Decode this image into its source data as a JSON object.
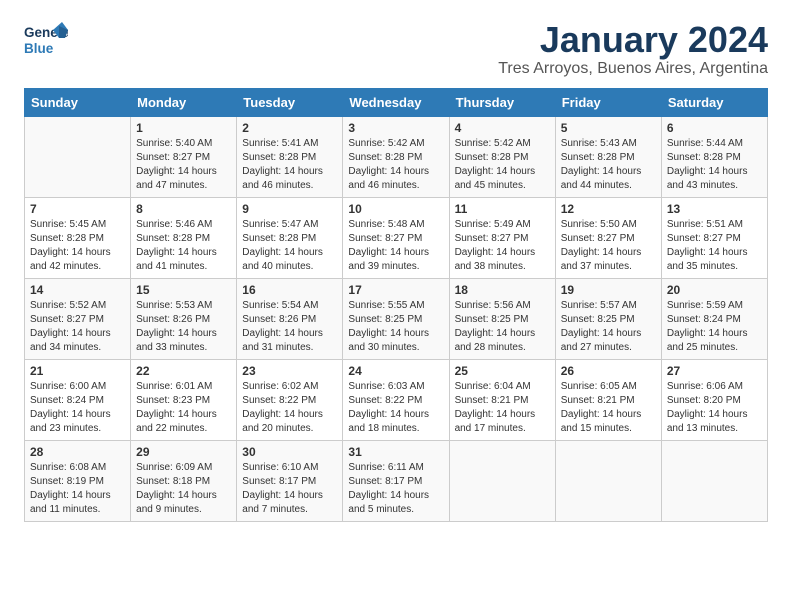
{
  "logo": {
    "line1": "General",
    "line2": "Blue"
  },
  "title": "January 2024",
  "subtitle": "Tres Arroyos, Buenos Aires, Argentina",
  "days_of_week": [
    "Sunday",
    "Monday",
    "Tuesday",
    "Wednesday",
    "Thursday",
    "Friday",
    "Saturday"
  ],
  "weeks": [
    [
      {
        "day": "",
        "content": ""
      },
      {
        "day": "1",
        "content": "Sunrise: 5:40 AM\nSunset: 8:27 PM\nDaylight: 14 hours\nand 47 minutes."
      },
      {
        "day": "2",
        "content": "Sunrise: 5:41 AM\nSunset: 8:28 PM\nDaylight: 14 hours\nand 46 minutes."
      },
      {
        "day": "3",
        "content": "Sunrise: 5:42 AM\nSunset: 8:28 PM\nDaylight: 14 hours\nand 46 minutes."
      },
      {
        "day": "4",
        "content": "Sunrise: 5:42 AM\nSunset: 8:28 PM\nDaylight: 14 hours\nand 45 minutes."
      },
      {
        "day": "5",
        "content": "Sunrise: 5:43 AM\nSunset: 8:28 PM\nDaylight: 14 hours\nand 44 minutes."
      },
      {
        "day": "6",
        "content": "Sunrise: 5:44 AM\nSunset: 8:28 PM\nDaylight: 14 hours\nand 43 minutes."
      }
    ],
    [
      {
        "day": "7",
        "content": "Sunrise: 5:45 AM\nSunset: 8:28 PM\nDaylight: 14 hours\nand 42 minutes."
      },
      {
        "day": "8",
        "content": "Sunrise: 5:46 AM\nSunset: 8:28 PM\nDaylight: 14 hours\nand 41 minutes."
      },
      {
        "day": "9",
        "content": "Sunrise: 5:47 AM\nSunset: 8:28 PM\nDaylight: 14 hours\nand 40 minutes."
      },
      {
        "day": "10",
        "content": "Sunrise: 5:48 AM\nSunset: 8:27 PM\nDaylight: 14 hours\nand 39 minutes."
      },
      {
        "day": "11",
        "content": "Sunrise: 5:49 AM\nSunset: 8:27 PM\nDaylight: 14 hours\nand 38 minutes."
      },
      {
        "day": "12",
        "content": "Sunrise: 5:50 AM\nSunset: 8:27 PM\nDaylight: 14 hours\nand 37 minutes."
      },
      {
        "day": "13",
        "content": "Sunrise: 5:51 AM\nSunset: 8:27 PM\nDaylight: 14 hours\nand 35 minutes."
      }
    ],
    [
      {
        "day": "14",
        "content": "Sunrise: 5:52 AM\nSunset: 8:27 PM\nDaylight: 14 hours\nand 34 minutes."
      },
      {
        "day": "15",
        "content": "Sunrise: 5:53 AM\nSunset: 8:26 PM\nDaylight: 14 hours\nand 33 minutes."
      },
      {
        "day": "16",
        "content": "Sunrise: 5:54 AM\nSunset: 8:26 PM\nDaylight: 14 hours\nand 31 minutes."
      },
      {
        "day": "17",
        "content": "Sunrise: 5:55 AM\nSunset: 8:25 PM\nDaylight: 14 hours\nand 30 minutes."
      },
      {
        "day": "18",
        "content": "Sunrise: 5:56 AM\nSunset: 8:25 PM\nDaylight: 14 hours\nand 28 minutes."
      },
      {
        "day": "19",
        "content": "Sunrise: 5:57 AM\nSunset: 8:25 PM\nDaylight: 14 hours\nand 27 minutes."
      },
      {
        "day": "20",
        "content": "Sunrise: 5:59 AM\nSunset: 8:24 PM\nDaylight: 14 hours\nand 25 minutes."
      }
    ],
    [
      {
        "day": "21",
        "content": "Sunrise: 6:00 AM\nSunset: 8:24 PM\nDaylight: 14 hours\nand 23 minutes."
      },
      {
        "day": "22",
        "content": "Sunrise: 6:01 AM\nSunset: 8:23 PM\nDaylight: 14 hours\nand 22 minutes."
      },
      {
        "day": "23",
        "content": "Sunrise: 6:02 AM\nSunset: 8:22 PM\nDaylight: 14 hours\nand 20 minutes."
      },
      {
        "day": "24",
        "content": "Sunrise: 6:03 AM\nSunset: 8:22 PM\nDaylight: 14 hours\nand 18 minutes."
      },
      {
        "day": "25",
        "content": "Sunrise: 6:04 AM\nSunset: 8:21 PM\nDaylight: 14 hours\nand 17 minutes."
      },
      {
        "day": "26",
        "content": "Sunrise: 6:05 AM\nSunset: 8:21 PM\nDaylight: 14 hours\nand 15 minutes."
      },
      {
        "day": "27",
        "content": "Sunrise: 6:06 AM\nSunset: 8:20 PM\nDaylight: 14 hours\nand 13 minutes."
      }
    ],
    [
      {
        "day": "28",
        "content": "Sunrise: 6:08 AM\nSunset: 8:19 PM\nDaylight: 14 hours\nand 11 minutes."
      },
      {
        "day": "29",
        "content": "Sunrise: 6:09 AM\nSunset: 8:18 PM\nDaylight: 14 hours\nand 9 minutes."
      },
      {
        "day": "30",
        "content": "Sunrise: 6:10 AM\nSunset: 8:17 PM\nDaylight: 14 hours\nand 7 minutes."
      },
      {
        "day": "31",
        "content": "Sunrise: 6:11 AM\nSunset: 8:17 PM\nDaylight: 14 hours\nand 5 minutes."
      },
      {
        "day": "",
        "content": ""
      },
      {
        "day": "",
        "content": ""
      },
      {
        "day": "",
        "content": ""
      }
    ]
  ]
}
